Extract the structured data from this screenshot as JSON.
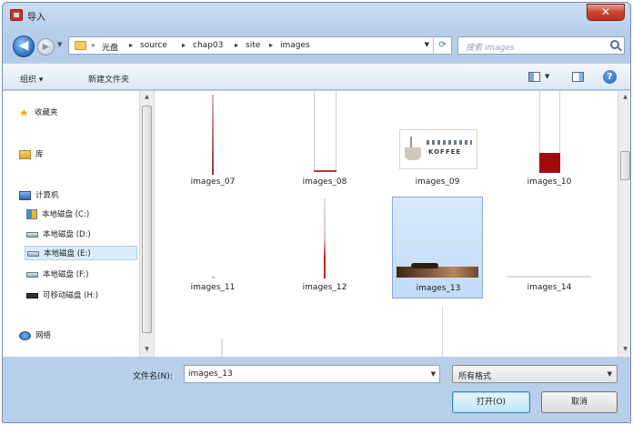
{
  "window": {
    "title": "导入",
    "close_label": "✕"
  },
  "nav": {
    "back_glyph": "◀",
    "forward_glyph": "▶",
    "breadcrumb": [
      "光盘",
      "source",
      "chap03",
      "site",
      "images"
    ],
    "search_placeholder": "搜索 images"
  },
  "toolbar": {
    "organize_label": "组织 ▾",
    "new_folder_label": "新建文件夹",
    "help_glyph": "?"
  },
  "sidebar": {
    "favorites": "收藏夹",
    "libraries": "库",
    "computer": "计算机",
    "drives": [
      {
        "label": "本地磁盘 (C:)",
        "icon": "winlogo"
      },
      {
        "label": "本地磁盘 (D:)",
        "icon": "drive"
      },
      {
        "label": "本地磁盘 (E:)",
        "icon": "drive",
        "selected": true
      },
      {
        "label": "本地磁盘 (F:)",
        "icon": "drive"
      },
      {
        "label": "可移动磁盘 (H:)",
        "icon": "usb"
      }
    ],
    "network": "网络"
  },
  "files": [
    {
      "name": "images_07"
    },
    {
      "name": "images_08"
    },
    {
      "name": "images_09",
      "thumb_text": "KOFFEE"
    },
    {
      "name": "images_10"
    },
    {
      "name": "images_11"
    },
    {
      "name": "images_12"
    },
    {
      "name": "images_13",
      "selected": true
    },
    {
      "name": "images_14"
    }
  ],
  "footer": {
    "filename_label": "文件名(N):",
    "filename_value": "images_13",
    "filetype_value": "所有格式",
    "open_label": "打开(O)",
    "cancel_label": "取消"
  },
  "colors": {
    "accent": "#3c7fb1",
    "selection": "#c2dbf7",
    "red_swatch": "#a00c0c"
  }
}
